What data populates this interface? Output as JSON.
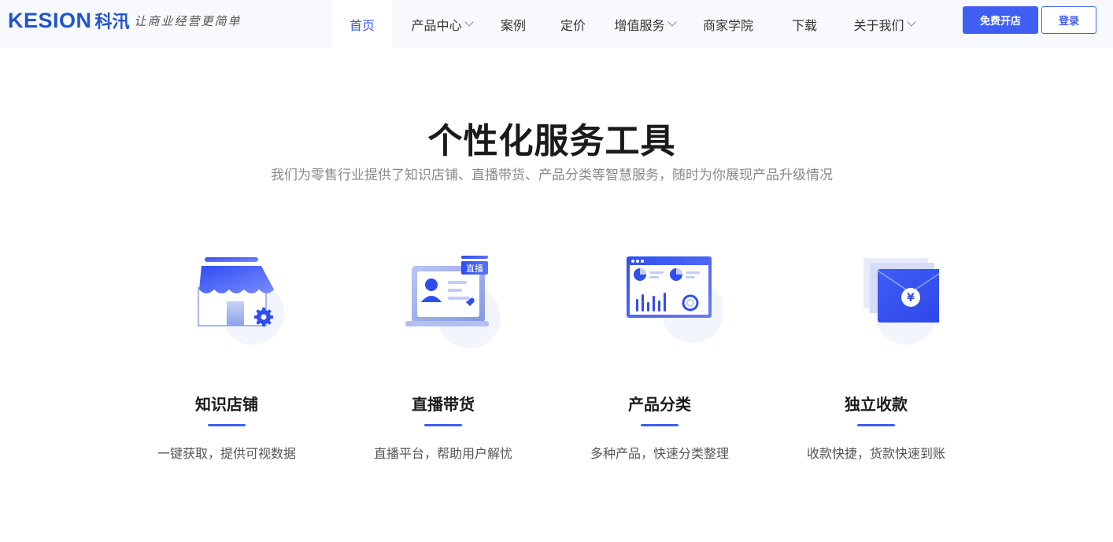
{
  "header": {
    "logo_en": "KESION",
    "logo_cn": "科汛",
    "slogan": "让商业经营更简单",
    "nav": [
      {
        "label": "首页",
        "active": true,
        "dropdown": false
      },
      {
        "label": "产品中心",
        "active": false,
        "dropdown": true
      },
      {
        "label": "案例",
        "active": false,
        "dropdown": false
      },
      {
        "label": "定价",
        "active": false,
        "dropdown": false
      },
      {
        "label": "增值服务",
        "active": false,
        "dropdown": true
      },
      {
        "label": "商家学院",
        "active": false,
        "dropdown": false
      },
      {
        "label": "下载",
        "active": false,
        "dropdown": false
      },
      {
        "label": "关于我们",
        "active": false,
        "dropdown": true
      }
    ],
    "primary_button": "免费开店",
    "login_button": "登录"
  },
  "section": {
    "title": "个性化服务工具",
    "subtitle": "我们为零售行业提供了知识店铺、直播带货、产品分类等智慧服务，随时为你展现产品升级情况",
    "features": [
      {
        "icon": "shop-icon",
        "title": "知识店铺",
        "desc": "一键获取，提供可视数据"
      },
      {
        "icon": "live-stream-icon",
        "title": "直播带货",
        "desc": "直播平台，帮助用户解忧",
        "badge": "直播"
      },
      {
        "icon": "dashboard-icon",
        "title": "产品分类",
        "desc": "多种产品，快速分类整理"
      },
      {
        "icon": "payment-envelope-icon",
        "title": "独立收款",
        "desc": "收款快捷，货款快速到账",
        "symbol": "¥"
      }
    ]
  },
  "colors": {
    "accent": "#3f5ef3",
    "logo": "#1f56c9",
    "header_bg": "#f7f9fc"
  }
}
